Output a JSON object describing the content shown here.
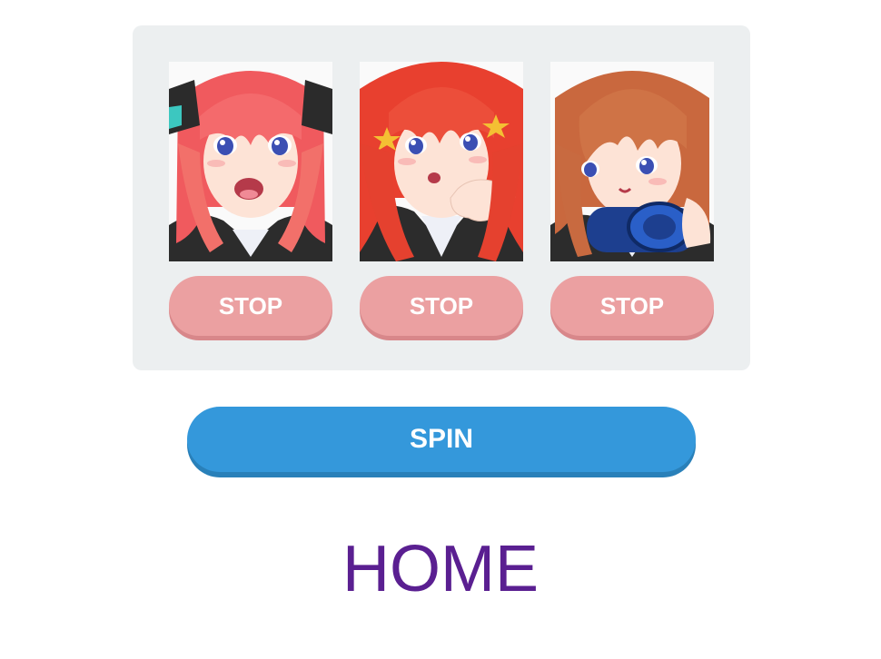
{
  "reels": [
    {
      "character": "character-portrait-1",
      "hair_color": "#f05a5e",
      "stop_label": "STOP"
    },
    {
      "character": "character-portrait-2",
      "hair_color": "#e8402f",
      "stop_label": "STOP"
    },
    {
      "character": "character-portrait-3",
      "hair_color": "#c9683e",
      "stop_label": "STOP"
    }
  ],
  "spin_label": "SPIN",
  "home_label": "HOME",
  "colors": {
    "panel_bg": "#eceff0",
    "stop_button": "#eba0a1",
    "spin_button": "#3498db",
    "home_link": "#5a1f91"
  }
}
